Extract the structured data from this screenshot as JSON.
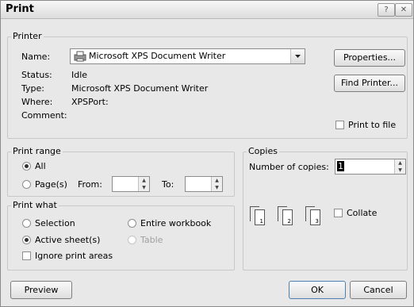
{
  "window": {
    "title": "Print",
    "help_btn": "?",
    "close_btn": "✕"
  },
  "printer": {
    "group_label": "Printer",
    "name_label": "Name:",
    "name_value": "Microsoft XPS Document Writer",
    "status_label": "Status:",
    "status_value": "Idle",
    "type_label": "Type:",
    "type_value": "Microsoft XPS Document Writer",
    "where_label": "Where:",
    "where_value": "XPSPort:",
    "comment_label": "Comment:",
    "properties_btn": "Properties...",
    "find_printer_btn": "Find Printer...",
    "print_to_file": "Print to file"
  },
  "print_range": {
    "group_label": "Print range",
    "all": "All",
    "pages": "Page(s)",
    "from": "From:",
    "to": "To:"
  },
  "print_what": {
    "group_label": "Print what",
    "selection": "Selection",
    "entire_workbook": "Entire workbook",
    "active_sheets": "Active sheet(s)",
    "table": "Table",
    "ignore_print_areas": "Ignore print areas"
  },
  "copies": {
    "group_label": "Copies",
    "number_label": "Number of copies:",
    "number_value": "1",
    "collate": "Collate",
    "page_numbers": [
      "1",
      "2",
      "3"
    ]
  },
  "buttons": {
    "preview": "Preview",
    "ok": "OK",
    "cancel": "Cancel"
  }
}
